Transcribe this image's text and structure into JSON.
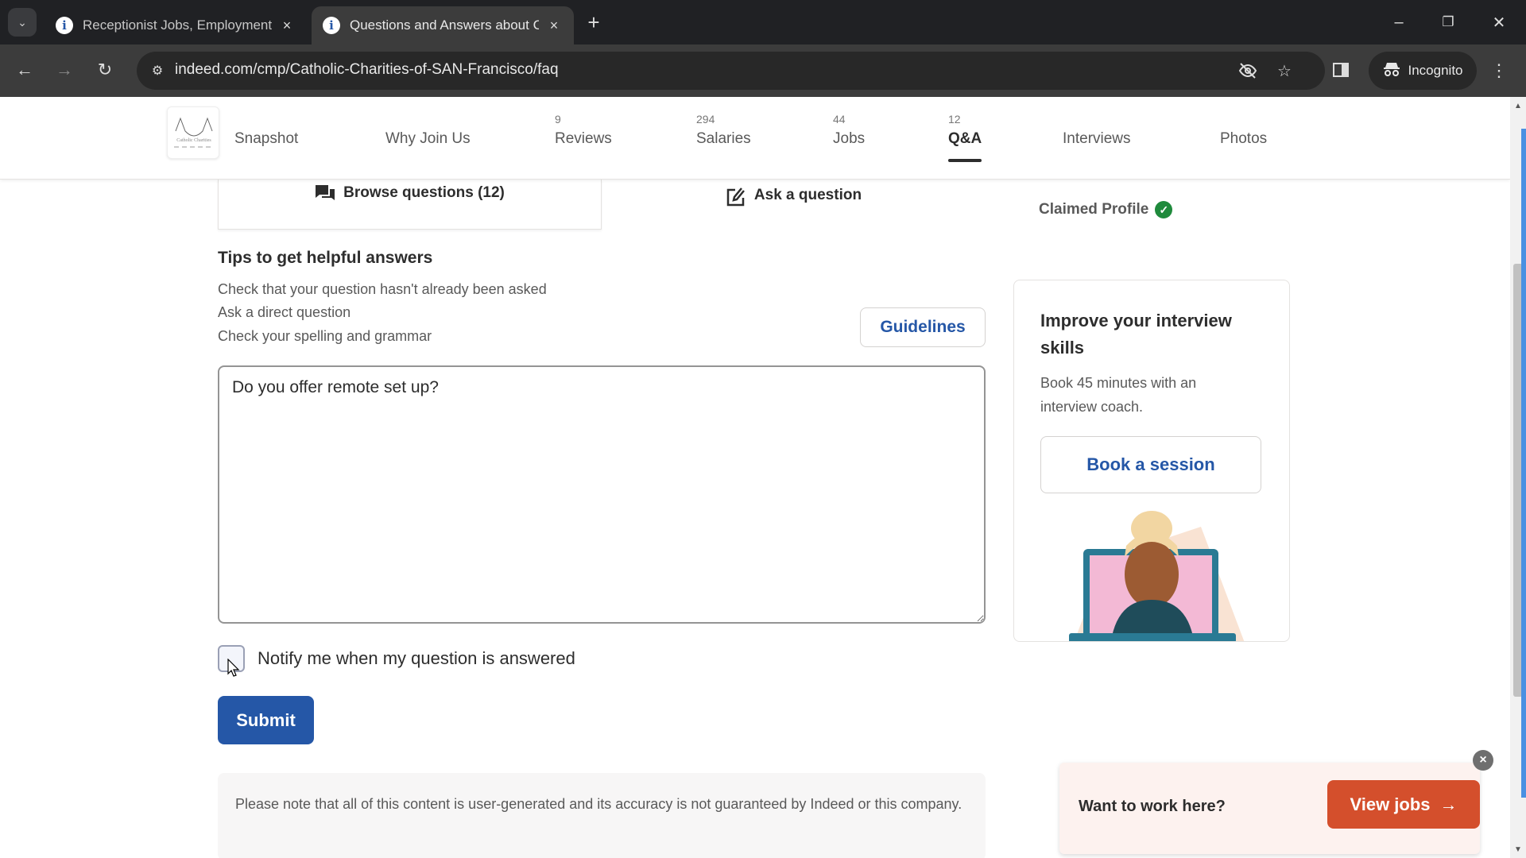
{
  "browser": {
    "tabs": [
      {
        "title": "Receptionist Jobs, Employment",
        "active": false
      },
      {
        "title": "Questions and Answers about C",
        "active": true
      }
    ],
    "url": "indeed.com/cmp/Catholic-Charities-of-SAN-Francisco/faq",
    "incognito_label": "Incognito",
    "icons": {
      "tab_search": "chevron-down-icon",
      "favicon": "info-icon",
      "close": "×",
      "new_tab": "+",
      "minimize": "–",
      "restore": "❐",
      "window_close": "✕",
      "back": "←",
      "forward": "→",
      "reload": "↻",
      "site_info": "⚙",
      "eye_off": "eye-off-icon",
      "star": "☆",
      "side_panel": "▮",
      "menu": "⋮"
    }
  },
  "company_nav": {
    "logo_alt": "Catholic Charities",
    "items": [
      {
        "label": "Snapshot",
        "count": ""
      },
      {
        "label": "Why Join Us",
        "count": ""
      },
      {
        "label": "Reviews",
        "count": "9"
      },
      {
        "label": "Salaries",
        "count": "294"
      },
      {
        "label": "Jobs",
        "count": "44"
      },
      {
        "label": "Q&A",
        "count": "12",
        "active": true
      },
      {
        "label": "Interviews",
        "count": ""
      },
      {
        "label": "Photos",
        "count": ""
      }
    ]
  },
  "qa": {
    "browse_tab": "Browse questions (12)",
    "ask_tab": "Ask a question",
    "claimed_profile": "Claimed Profile",
    "tips_heading": "Tips to get helpful answers",
    "tips": [
      "Check that your question hasn't already been asked",
      "Ask a direct question",
      "Check your spelling and grammar"
    ],
    "guidelines_button": "Guidelines",
    "question_value": "Do you offer remote set up?",
    "notify_label": "Notify me when my question is answered",
    "notify_checked": false,
    "submit_button": "Submit",
    "disclaimer": "Please note that all of this content is user-generated and its accuracy is not guaranteed by Indeed or this company."
  },
  "coach_card": {
    "title": "Improve your interview skills",
    "description": "Book 45 minutes with an interview coach.",
    "button": "Book a session"
  },
  "sticky_bar": {
    "text": "Want to work here?",
    "button": "View jobs",
    "button_arrow": "→",
    "close": "×"
  },
  "colors": {
    "brand_blue": "#2557a7",
    "view_jobs_orange": "#d44f2c",
    "claimed_green": "#1f8a3c",
    "sticky_bg": "#fdf2ef"
  }
}
